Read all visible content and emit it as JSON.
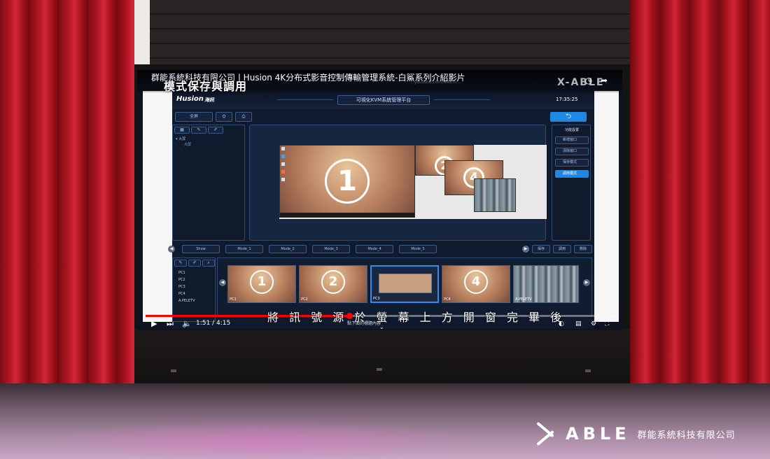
{
  "video": {
    "title": "群能系統科技有限公司 | Husion 4K分布式影音控制傳輸管理系統-白鯊系列介紹影片",
    "overlay_caption": "模式保存與調用",
    "watermark": "X-ABLE",
    "url_hint": "...youtube.com/watch?...",
    "subtitle": "將 訊 號 源 於 螢 幕 上 方 開 窗 完 畢 後",
    "time": "1:51 / 4:15",
    "progress_fraction": 0.435,
    "below_hint": "點下面的標題內容"
  },
  "app": {
    "logo": "Husion",
    "logo_sub": "海訊",
    "center_title": "可視化KVM系統管理平台",
    "clock": "17:35:25",
    "toolbar": [
      "全屏",
      "⛭",
      "⎙"
    ],
    "tree": [
      "▾ 大屏",
      "大屏"
    ],
    "side_header": "功能設置",
    "side_buttons": [
      "新增窗口",
      "清除窗口",
      "保存模式",
      "調用模式"
    ],
    "modes": [
      "Show",
      "Mode_1",
      "Mode_2",
      "Mode_3",
      "Mode_4",
      "Mode_5"
    ],
    "mode_actions": [
      "保存",
      "調用",
      "刪除"
    ],
    "sources": [
      "PC1",
      "PC2",
      "PC3",
      "PC4",
      "A.PELETV"
    ],
    "thumbs": [
      {
        "label": "PC1",
        "num": "1"
      },
      {
        "label": "PC2",
        "num": "2"
      },
      {
        "label": "PC3",
        "num": ""
      },
      {
        "label": "PC4",
        "num": "4"
      },
      {
        "label": "A.PELETV",
        "num": ""
      }
    ],
    "windows": [
      "1",
      "2",
      "4"
    ]
  },
  "brand": {
    "word": "ABLE",
    "company": "群能系統科技有限公司"
  },
  "colors": {
    "accent": "#1e88e5",
    "progress": "#ff0000",
    "curtain": "#b31622"
  }
}
